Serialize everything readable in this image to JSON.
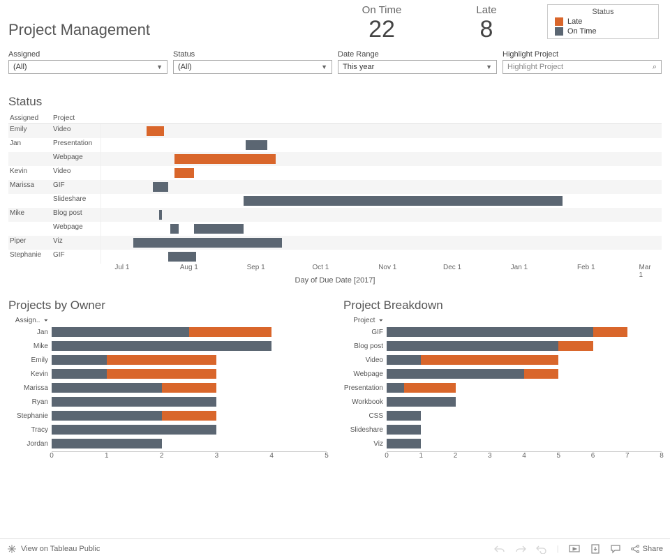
{
  "colors": {
    "late": "#d9662b",
    "ontime": "#5b6672"
  },
  "title": "Project Management",
  "kpis": [
    {
      "label": "On Time",
      "value": "22"
    },
    {
      "label": "Late",
      "value": "8"
    }
  ],
  "legend": {
    "title": "Status",
    "items": [
      {
        "label": "Late",
        "color_key": "late"
      },
      {
        "label": "On Time",
        "color_key": "ontime"
      }
    ]
  },
  "filters": {
    "assigned": {
      "label": "Assigned",
      "value": "(All)"
    },
    "status": {
      "label": "Status",
      "value": "(All)"
    },
    "date_range": {
      "label": "Date Range",
      "value": "This year"
    },
    "highlight": {
      "label": "Highlight Project",
      "placeholder": "Highlight Project"
    }
  },
  "gantt": {
    "title": "Status",
    "col_assigned": "Assigned",
    "col_project": "Project",
    "axis_label": "Day of Due Date [2017]",
    "ticks": [
      "Jul 1",
      "Aug 1",
      "Sep 1",
      "Oct 1",
      "Nov 1",
      "Dec 1",
      "Jan 1",
      "Feb 1",
      "Mar 1"
    ]
  },
  "owners": {
    "title": "Projects by Owner",
    "col": "Assign.."
  },
  "breakdown": {
    "title": "Project Breakdown",
    "col": "Project"
  },
  "footer": {
    "view": "View on Tableau Public",
    "share": "Share"
  },
  "chart_data": [
    {
      "type": "bar",
      "name": "gantt",
      "title": "Status",
      "xlabel": "Day of Due Date [2017]",
      "x_range_days": [
        -10,
        250
      ],
      "rows": [
        {
          "assigned": "Emily",
          "project": "Video",
          "start": 11,
          "end": 19,
          "status": "late"
        },
        {
          "assigned": "Jan",
          "project": "Presentation",
          "start": 57,
          "end": 67,
          "status": "ontime"
        },
        {
          "assigned": "Jan",
          "project": "Webpage",
          "start": 24,
          "end": 71,
          "status": "late"
        },
        {
          "assigned": "Kevin",
          "project": "Video",
          "start": 24,
          "end": 33,
          "status": "late"
        },
        {
          "assigned": "Marissa",
          "project": "GIF",
          "start": 14,
          "end": 21,
          "status": "ontime"
        },
        {
          "assigned": "Marissa",
          "project": "Slideshare",
          "start": 56,
          "end": 204,
          "status": "ontime"
        },
        {
          "assigned": "Mike",
          "project": "Blog post",
          "start": 17,
          "end": 18,
          "status": "ontime"
        },
        {
          "assigned": "Mike",
          "project": "Webpage",
          "start": 22,
          "end": 26,
          "status": "ontime",
          "extra": {
            "start": 33,
            "end": 56,
            "status": "ontime"
          }
        },
        {
          "assigned": "Piper",
          "project": "Viz",
          "start": 5,
          "end": 74,
          "status": "ontime"
        },
        {
          "assigned": "Stephanie",
          "project": "GIF",
          "start": 21,
          "end": 34,
          "status": "ontime"
        }
      ]
    },
    {
      "type": "bar",
      "name": "projects_by_owner",
      "title": "Projects by Owner",
      "xlabel": "",
      "ylabel": "Assigned",
      "xlim": [
        0,
        5
      ],
      "categories": [
        "Jan",
        "Mike",
        "Emily",
        "Kevin",
        "Marissa",
        "Ryan",
        "Stephanie",
        "Tracy",
        "Jordan"
      ],
      "series": [
        {
          "name": "On Time",
          "color_key": "ontime",
          "values": [
            2.5,
            4,
            1,
            1,
            2,
            3,
            2,
            3,
            2
          ]
        },
        {
          "name": "Late",
          "color_key": "late",
          "values": [
            1.5,
            0,
            2,
            2,
            1,
            0,
            1,
            0,
            0
          ]
        }
      ]
    },
    {
      "type": "bar",
      "name": "project_breakdown",
      "title": "Project Breakdown",
      "xlabel": "",
      "ylabel": "Project",
      "xlim": [
        0,
        8
      ],
      "categories": [
        "GIF",
        "Blog post",
        "Video",
        "Webpage",
        "Presentation",
        "Workbook",
        "CSS",
        "Slideshare",
        "Viz"
      ],
      "series": [
        {
          "name": "On Time",
          "color_key": "ontime",
          "values": [
            6,
            5,
            1,
            4,
            0.5,
            2,
            1,
            1,
            1
          ]
        },
        {
          "name": "Late",
          "color_key": "late",
          "values": [
            1,
            1,
            4,
            1,
            1.5,
            0,
            0,
            0,
            0
          ]
        }
      ]
    }
  ]
}
